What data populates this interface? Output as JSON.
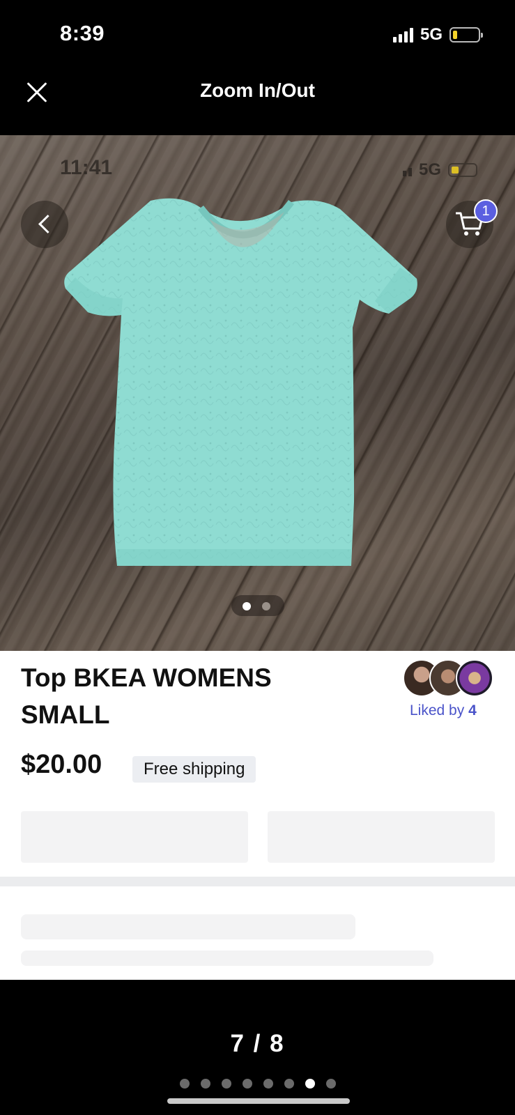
{
  "status_bar": {
    "time": "8:39",
    "network": "5G"
  },
  "top_bar": {
    "title": "Zoom In/Out"
  },
  "photo": {
    "screenshot_time": "11:41",
    "screenshot_network": "5G",
    "cart_count": "1",
    "image_count": 2,
    "active_image": 1
  },
  "listing": {
    "title": "Top BKEA WOMENS SMALL",
    "liked_by_label": "Liked by",
    "liked_by_count": "4",
    "price": "$20.00",
    "shipping_badge": "Free shipping"
  },
  "viewer": {
    "counter": "7 / 8",
    "total": 8,
    "current": 7
  }
}
